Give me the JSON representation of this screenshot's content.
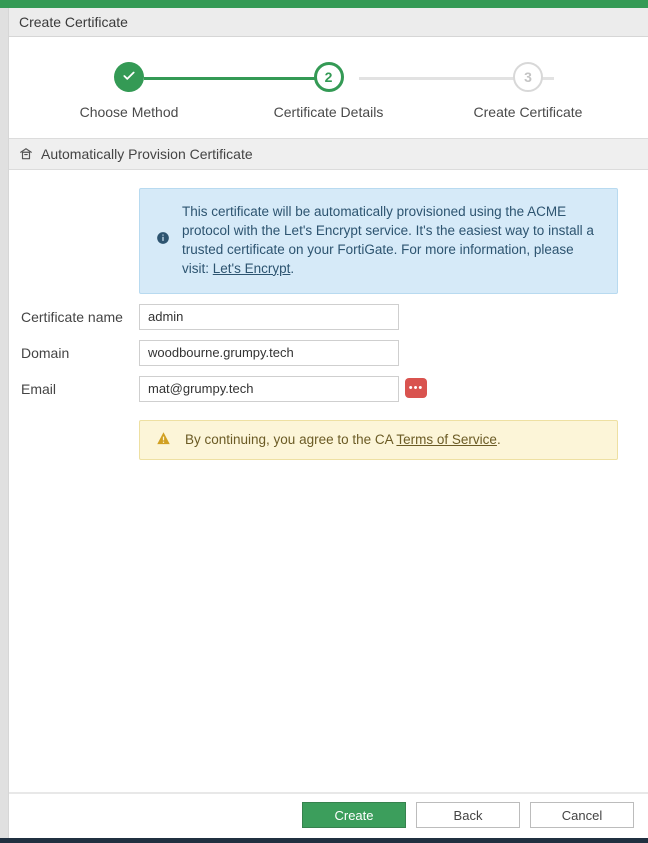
{
  "header": {
    "title": "Create Certificate"
  },
  "stepper": {
    "steps": [
      {
        "label": "Choose Method",
        "status": "done"
      },
      {
        "label": "Certificate Details",
        "number": "2",
        "status": "current"
      },
      {
        "label": "Create Certificate",
        "number": "3",
        "status": "upcoming"
      }
    ]
  },
  "section": {
    "title": "Automatically Provision Certificate"
  },
  "info": {
    "text": "This certificate will be automatically provisioned using the ACME protocol with the Let's Encrypt service. It's the easiest way to install a trusted certificate on your FortiGate. For more information, please visit: ",
    "link_label": "Let's Encrypt",
    "trailing": "."
  },
  "form": {
    "certificate_name": {
      "label": "Certificate name",
      "value": "admin"
    },
    "domain": {
      "label": "Domain",
      "value": "woodbourne.grumpy.tech"
    },
    "email": {
      "label": "Email",
      "value": "mat@grumpy.tech",
      "tag": "•••"
    }
  },
  "warning": {
    "prefix": "By continuing, you agree to the CA ",
    "link_label": "Terms of Service",
    "suffix": "."
  },
  "buttons": {
    "create": "Create",
    "back": "Back",
    "cancel": "Cancel"
  }
}
